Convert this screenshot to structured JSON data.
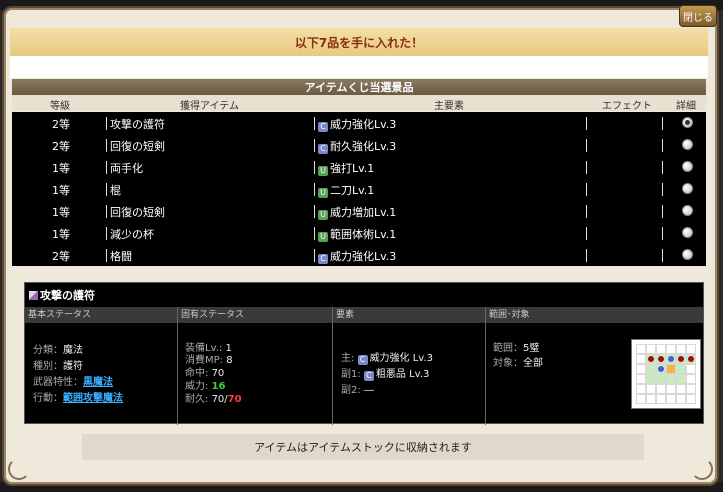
{
  "window": {
    "close_label": "閉じる",
    "message": "以下7品を手に入れた！"
  },
  "prize": {
    "title": "アイテムくじ当選景品",
    "headers": {
      "rank": "等級",
      "item": "獲得アイテム",
      "element": "主要素",
      "effect": "エフェクト",
      "detail": "詳細"
    },
    "rows": [
      {
        "rank": "2等",
        "item": "攻撃の護符",
        "badge": "C",
        "element": "威力強化Lv.3"
      },
      {
        "rank": "2等",
        "item": "回復の短剣",
        "badge": "C",
        "element": "耐久強化Lv.3"
      },
      {
        "rank": "1等",
        "item": "両手化",
        "badge": "U",
        "element": "強打Lv.1"
      },
      {
        "rank": "1等",
        "item": "棍",
        "badge": "U",
        "element": "二刀Lv.1"
      },
      {
        "rank": "1等",
        "item": "回復の短剣",
        "badge": "U",
        "element": "威力増加Lv.1"
      },
      {
        "rank": "1等",
        "item": "減少の杯",
        "badge": "U",
        "element": "範囲体術Lv.1"
      },
      {
        "rank": "2等",
        "item": "格闘",
        "badge": "C",
        "element": "威力強化Lv.3"
      }
    ]
  },
  "detail": {
    "title": "攻撃の護符",
    "headers": {
      "basic": "基本ステータス",
      "own": "固有ステータス",
      "element": "要素",
      "range": "範囲･対象"
    },
    "basic": {
      "class_label": "分類：",
      "class_value": "魔法",
      "kind_label": "種別：",
      "kind_value": "護符",
      "trait_label": "武器特性：",
      "trait_value": "黒魔法",
      "action_label": "行動：",
      "action_value": "範囲攻撃魔法"
    },
    "own": {
      "equip_label": "装備Lv.:",
      "equip_value": "1",
      "mp_label": "消費MP:",
      "mp_value": "8",
      "hit_label": "命中:",
      "hit_value": "70",
      "power_label": "威力:",
      "power_value": "16",
      "dura_label": "耐久:",
      "dura_value": "70/",
      "dura_max": "70"
    },
    "element": {
      "main_label": "主:",
      "main_badge": "C",
      "main_value": "威力強化 Lv.3",
      "sub1_label": "副1:",
      "sub1_badge": "C",
      "sub1_value": "粗悪品 Lv.3",
      "sub2_label": "副2:",
      "sub2_value": "―"
    },
    "range": {
      "range_label": "範囲：",
      "range_value": "5璧",
      "target_label": "対象：",
      "target_value": "全部"
    }
  },
  "footer": {
    "message": "アイテムはアイテムストックに収納されます"
  },
  "colors": {
    "accent": "#3ab0ff",
    "power": "#3ad23a",
    "max": "#ff3a3a",
    "title": "#8a2d0e"
  }
}
